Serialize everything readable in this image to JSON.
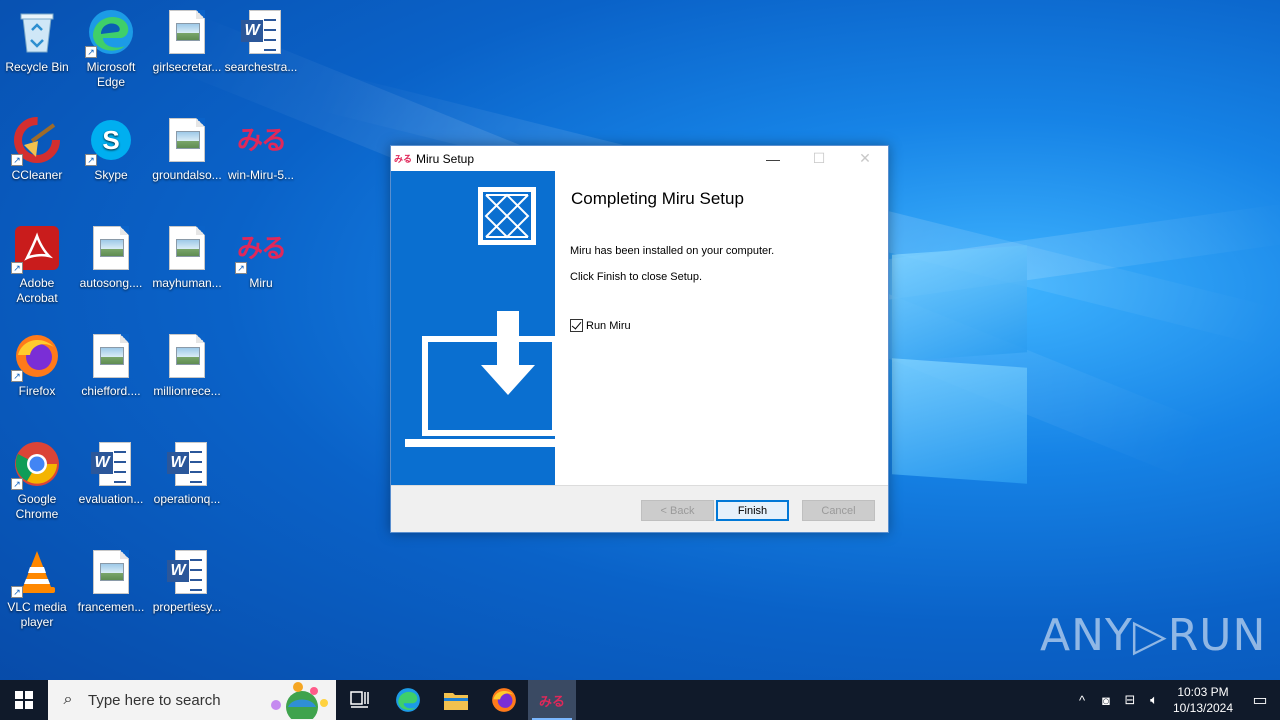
{
  "desktop": {
    "icons": [
      {
        "name": "recycle-bin",
        "label": "Recycle Bin"
      },
      {
        "name": "microsoft-edge",
        "label": "Microsoft Edge"
      },
      {
        "name": "girlsecretar",
        "label": "girlsecretar..."
      },
      {
        "name": "searchestra",
        "label": "searchestra..."
      },
      {
        "name": "ccleaner",
        "label": "CCleaner"
      },
      {
        "name": "skype",
        "label": "Skype"
      },
      {
        "name": "groundalso",
        "label": "groundalso..."
      },
      {
        "name": "win-miru",
        "label": "win-Miru-5..."
      },
      {
        "name": "adobe-acrobat",
        "label": "Adobe Acrobat"
      },
      {
        "name": "autosong",
        "label": "autosong...."
      },
      {
        "name": "mayhuman",
        "label": "mayhuman..."
      },
      {
        "name": "miru",
        "label": "Miru"
      },
      {
        "name": "firefox",
        "label": "Firefox"
      },
      {
        "name": "chiefford",
        "label": "chiefford...."
      },
      {
        "name": "millionrece",
        "label": "millionrece..."
      },
      {
        "name": "google-chrome",
        "label": "Google Chrome"
      },
      {
        "name": "evaluation",
        "label": "evaluation..."
      },
      {
        "name": "operationq",
        "label": "operationq..."
      },
      {
        "name": "vlc",
        "label": "VLC media player"
      },
      {
        "name": "francemen",
        "label": "francemen..."
      },
      {
        "name": "propertiesy",
        "label": "propertiesy..."
      }
    ],
    "miru_glyph": "みる",
    "watermark": "ANY▷RUN"
  },
  "dialog": {
    "title": "Miru Setup",
    "app_glyph": "みる",
    "heading": "Completing Miru Setup",
    "line1": "Miru has been installed on your computer.",
    "line2": "Click Finish to close Setup.",
    "checkbox_label": "Run Miru",
    "checkbox_checked": true,
    "buttons": {
      "back": "< Back",
      "finish": "Finish",
      "cancel": "Cancel"
    }
  },
  "taskbar": {
    "search_placeholder": "Type here to search",
    "active_app_glyph": "みる",
    "time": "10:03 PM",
    "date": "10/13/2024"
  },
  "colors": {
    "accent": "#0a6fd0",
    "brand_miru": "#e0285a"
  }
}
